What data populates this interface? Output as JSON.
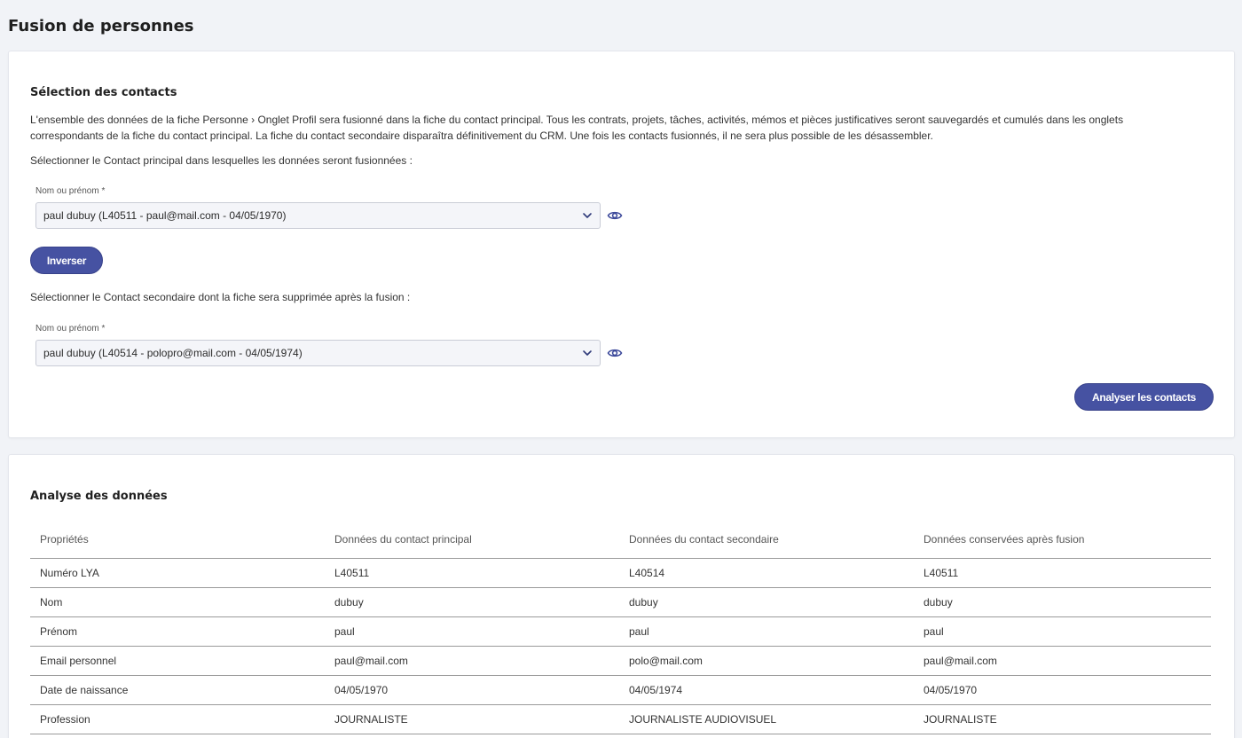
{
  "page": {
    "title": "Fusion de personnes"
  },
  "selection": {
    "title": "Sélection des contacts",
    "description": "L'ensemble des données de la fiche Personne › Onglet Profil sera fusionné dans la fiche du contact principal. Tous les contrats, projets, tâches, activités, mémos et pièces justificatives seront sauvegardés et cumulés dans les onglets correspondants de la fiche du contact principal. La fiche du contact secondaire disparaîtra définitivement du CRM. Une fois les contacts fusionnés, il ne sera plus possible de les désassembler.",
    "principal_instruction": "Sélectionner le Contact principal dans lesquelles les données seront fusionnées :",
    "principal_label": "Nom ou prénom *",
    "principal_value": "paul dubuy (L40511 - paul@mail.com - 04/05/1970)",
    "invert_label": "Inverser",
    "secondary_instruction": "Sélectionner le Contact secondaire dont la fiche sera supprimée après la fusion :",
    "secondary_label": "Nom ou prénom *",
    "secondary_value": "paul dubuy (L40514 - polopro@mail.com - 04/05/1974)",
    "analyse_label": "Analyser les contacts"
  },
  "analysis": {
    "title": "Analyse des données",
    "headers": [
      "Propriétés",
      "Données du contact principal",
      "Données du contact secondaire",
      "Données conservées après fusion"
    ],
    "rows": [
      [
        "Numéro LYA",
        "L40511",
        "L40514",
        "L40511"
      ],
      [
        "Nom",
        "dubuy",
        "dubuy",
        "dubuy"
      ],
      [
        "Prénom",
        "paul",
        "paul",
        "paul"
      ],
      [
        "Email personnel",
        "paul@mail.com",
        "polo@mail.com",
        "paul@mail.com"
      ],
      [
        "Date de naissance",
        "04/05/1970",
        "04/05/1974",
        "04/05/1970"
      ],
      [
        "Profession",
        "JOURNALISTE",
        "JOURNALISTE AUDIOVISUEL",
        "JOURNALISTE"
      ]
    ]
  },
  "colors": {
    "accent": "#4652a2",
    "background": "#f1f3f7",
    "card": "#ffffff",
    "icon": "#3d4a9b"
  },
  "icons": {
    "chevron": "chevron-down-icon",
    "eye": "eye-icon"
  }
}
